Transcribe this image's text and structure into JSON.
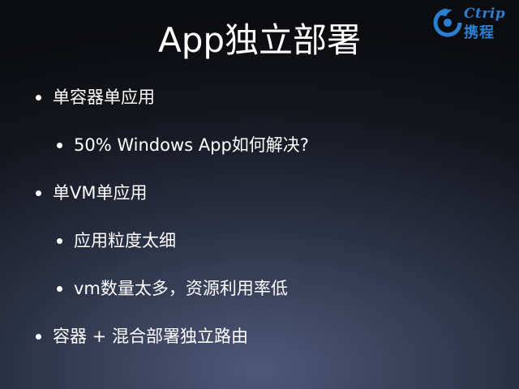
{
  "slide": {
    "title": "App独立部署",
    "logo": {
      "brand_en": "Ctrip",
      "brand_cn": "携程",
      "icon": "dolphin-icon",
      "color": "#2b7fd1"
    },
    "bullets": [
      {
        "level": 1,
        "text": "单容器单应用"
      },
      {
        "level": 2,
        "text": "50% Windows App如何解决?"
      },
      {
        "level": 1,
        "text": "单VM单应用"
      },
      {
        "level": 2,
        "text": "应用粒度太细"
      },
      {
        "level": 2,
        "text": "vm数量太多，资源利用率低"
      },
      {
        "level": 1,
        "text": "容器 + 混合部署独立路由"
      }
    ]
  }
}
